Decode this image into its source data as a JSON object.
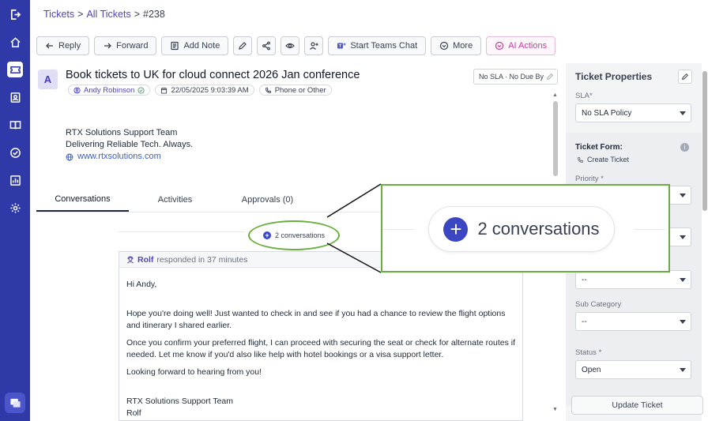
{
  "breadcrumb": {
    "tickets": "Tickets",
    "all_tickets": "All Tickets",
    "ticket_id": "#238",
    "sep": ">"
  },
  "toolbar": {
    "reply": "Reply",
    "forward": "Forward",
    "add_note": "Add Note",
    "start_teams_chat": "Start Teams Chat",
    "more": "More",
    "ai_actions": "AI Actions"
  },
  "ticket": {
    "avatar_letter": "A",
    "title": "Book tickets to UK for cloud connect 2026 Jan conference",
    "requester": "Andy Robinson",
    "created": "22/05/2025 9:03:39 AM",
    "source": "Phone or Other",
    "sla_status": "No SLA · No Due By"
  },
  "signature": {
    "team": "RTX Solutions Support Team",
    "tagline": "Delivering Reliable Tech. Always.",
    "website": "www.rtxsolutions.com"
  },
  "tabs": [
    {
      "label": "Conversations"
    },
    {
      "label": "Activities"
    },
    {
      "label": "Approvals (0)"
    }
  ],
  "conversations": {
    "count_label": "2 conversations",
    "plus": "+"
  },
  "message": {
    "author": "Rolf",
    "responded": "responded in 37 minutes",
    "greeting": "Hi Andy,",
    "para1": "Hope you're doing well! Just wanted to check in and see if you had a chance to review the flight options and itinerary I shared earlier.",
    "para2": "Once you confirm your preferred flight, I can proceed with securing the seat or check for alternate routes if needed. Let me know if you'd also like help with hotel bookings or a visa support letter.",
    "para3": "Looking forward to hearing from you!",
    "sig_team": "RTX Solutions Support Team",
    "sig_name": "Rolf"
  },
  "properties": {
    "title": "Ticket Properties",
    "sla_label": "SLA",
    "sla_value": "No SLA Policy",
    "ticket_form_label": "Ticket Form:",
    "ticket_form_value": "Create Ticket",
    "priority_label": "Priority",
    "category_value": "--",
    "sub_category_label": "Sub Category",
    "sub_category_value": "--",
    "status_label": "Status",
    "status_value": "Open",
    "required_mark": "*",
    "update_button": "Update Ticket"
  },
  "colors": {
    "rail": "#2f3aa8",
    "accent": "#4f46b8",
    "highlight": "#69ae3e",
    "ai": "#c2409b"
  }
}
